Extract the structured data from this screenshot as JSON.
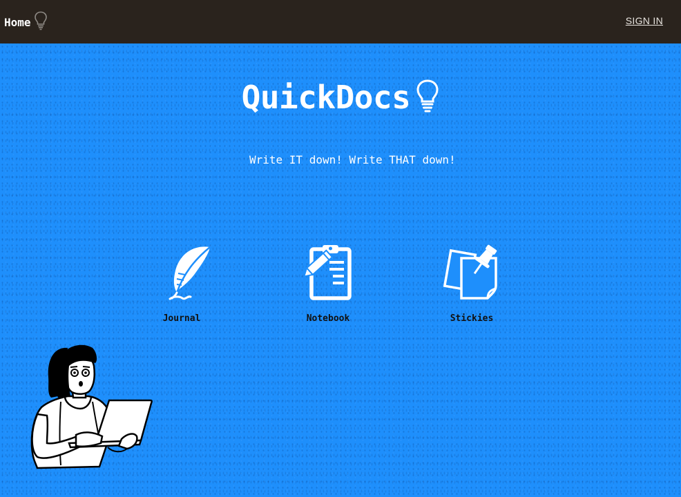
{
  "nav": {
    "home_label": "Home",
    "home_icon": "lightbulb-icon",
    "signin_label": "SIGN IN"
  },
  "hero": {
    "title": "QuickDocs",
    "title_icon": "lightbulb-icon",
    "tagline": "Write IT down! Write THAT down!"
  },
  "features": [
    {
      "label": "Journal",
      "icon": "quill-pen-icon"
    },
    {
      "label": "Notebook",
      "icon": "clipboard-pencil-icon"
    },
    {
      "label": "Stickies",
      "icon": "sticky-notes-pin-icon"
    }
  ],
  "colors": {
    "navbar_bg": "#2a231d",
    "page_bg": "#1e8ffc",
    "text_white": "#ffffff",
    "label_dark": "#111111"
  }
}
